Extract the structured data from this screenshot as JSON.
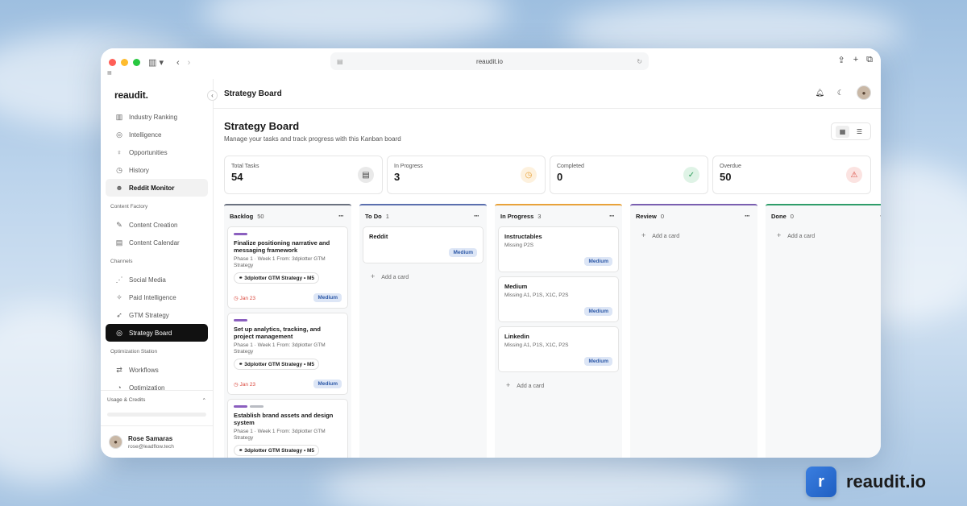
{
  "browser": {
    "url": "reaudit.io"
  },
  "sidebar": {
    "logo": "reaudit.",
    "items_top": [
      {
        "label": "Industry Ranking",
        "icon": "bar-chart-icon"
      },
      {
        "label": "Intelligence",
        "icon": "target-icon"
      },
      {
        "label": "Opportunities",
        "icon": "lightbulb-icon"
      },
      {
        "label": "History",
        "icon": "clock-icon"
      },
      {
        "label": "Reddit Monitor",
        "icon": "reddit-icon"
      }
    ],
    "section_content": "Content Factory",
    "items_content": [
      {
        "label": "Content Creation",
        "icon": "document-edit-icon"
      },
      {
        "label": "Content Calendar",
        "icon": "calendar-icon"
      }
    ],
    "section_channels": "Channels",
    "items_channels": [
      {
        "label": "Social Media",
        "icon": "share-icon"
      },
      {
        "label": "Paid Intelligence",
        "icon": "sparkle-icon"
      },
      {
        "label": "GTM Strategy",
        "icon": "rocket-icon"
      },
      {
        "label": "Strategy Board",
        "icon": "target-icon"
      }
    ],
    "section_optimization": "Optimization Station",
    "items_optimization": [
      {
        "label": "Workflows",
        "icon": "workflow-icon"
      },
      {
        "label": "Optimization",
        "icon": "gauge-icon"
      }
    ],
    "usage_label": "Usage & Credits",
    "user": {
      "name": "Rose Samaras",
      "email": "rose@leadflow.tech"
    }
  },
  "topbar": {
    "title": "Strategy Board"
  },
  "header": {
    "title": "Strategy Board",
    "subtitle": "Manage your tasks and track progress with this Kanban board"
  },
  "stats": [
    {
      "label": "Total Tasks",
      "value": "54",
      "icon": "document-icon",
      "color": "#444444",
      "bg": "#e9e9e9"
    },
    {
      "label": "In Progress",
      "value": "3",
      "icon": "clock-icon",
      "color": "#e8a23a",
      "bg": "#fdf1de"
    },
    {
      "label": "Completed",
      "value": "0",
      "icon": "check-circle-icon",
      "color": "#2f9d5c",
      "bg": "#dff3e6"
    },
    {
      "label": "Overdue",
      "value": "50",
      "icon": "warning-icon",
      "color": "#d9463b",
      "bg": "#fbe3e1"
    }
  ],
  "columns": [
    {
      "name": "Backlog",
      "count": "50",
      "color": "#6b7280",
      "cards": [
        {
          "title": "Finalize positioning narrative and messaging framework",
          "meta": "Phase 1 · Week 1 From: 3dplotter GTM Strategy",
          "tag": "3dplotter GTM Strategy • M5",
          "due": "Jan 23",
          "priority": "Medium",
          "bars": [
            "#8b5fbf"
          ]
        },
        {
          "title": "Set up analytics, tracking, and project management",
          "meta": "Phase 1 · Week 1 From: 3dplotter GTM Strategy",
          "tag": "3dplotter GTM Strategy • M5",
          "due": "Jan 23",
          "priority": "Medium",
          "bars": [
            "#8b5fbf"
          ]
        },
        {
          "title": "Establish brand assets and design system",
          "meta": "Phase 1 · Week 1 From: 3dplotter GTM Strategy",
          "tag": "3dplotter GTM Strategy • M5",
          "due": "",
          "priority": "",
          "bars": [
            "#8b5fbf",
            "#b9bcc3"
          ]
        }
      ],
      "add": ""
    },
    {
      "name": "To Do",
      "count": "1",
      "color": "#5b6fae",
      "cards": [
        {
          "title": "Reddit",
          "meta": "",
          "tag": "",
          "due": "",
          "priority": "Medium",
          "bars": []
        }
      ],
      "add": "Add a card"
    },
    {
      "name": "In Progress",
      "count": "3",
      "color": "#e8a23a",
      "cards": [
        {
          "title": "Instructables",
          "meta": "Missing P2S",
          "tag": "",
          "due": "",
          "priority": "Medium",
          "bars": []
        },
        {
          "title": "Medium",
          "meta": "Missing A1, P1S, X1C, P2S",
          "tag": "",
          "due": "",
          "priority": "Medium",
          "bars": []
        },
        {
          "title": "Linkedin",
          "meta": "Missing A1, P1S, X1C, P2S",
          "tag": "",
          "due": "",
          "priority": "Medium",
          "bars": []
        }
      ],
      "add": "Add a card"
    },
    {
      "name": "Review",
      "count": "0",
      "color": "#7a5fb0",
      "cards": [],
      "add": "Add a card"
    },
    {
      "name": "Done",
      "count": "0",
      "color": "#2f9d6a",
      "cards": [],
      "add": "Add a card"
    }
  ],
  "brand": {
    "name": "reaudit.io"
  }
}
